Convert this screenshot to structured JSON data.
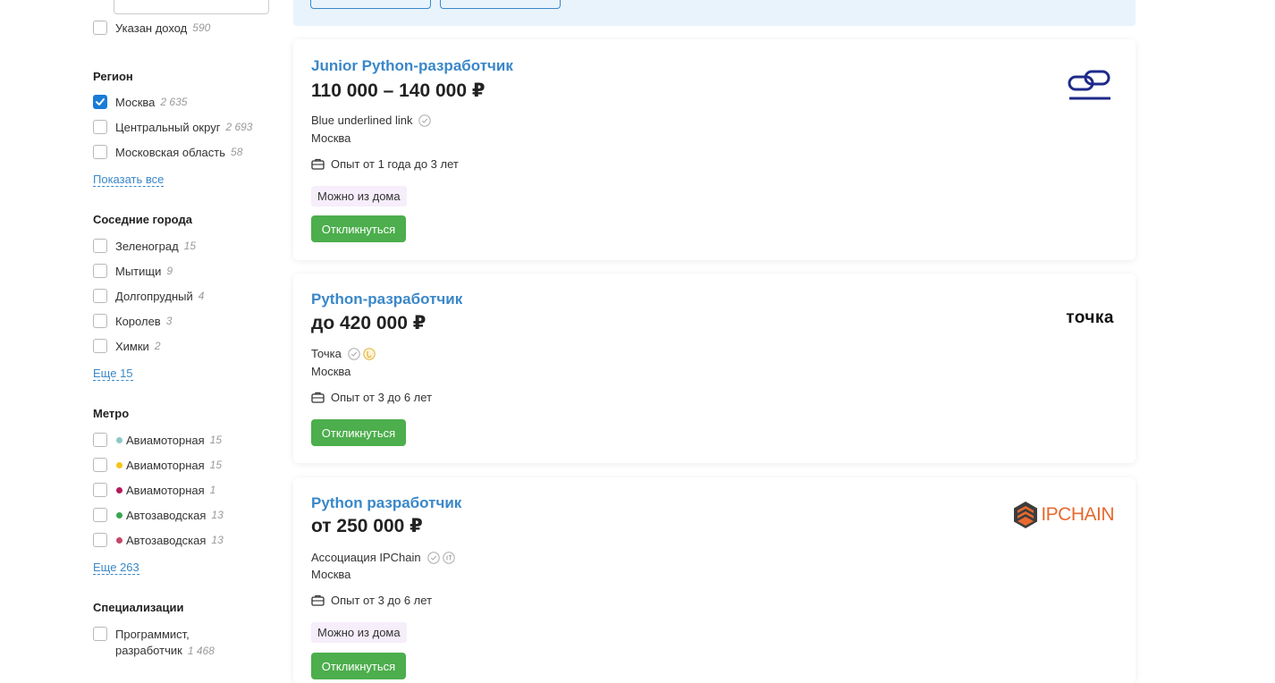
{
  "sidebar": {
    "income_filter": {
      "label": "Указан доход",
      "count": "590"
    },
    "region": {
      "title": "Регион",
      "items": [
        {
          "label": "Москва",
          "count": "2 635",
          "checked": true
        },
        {
          "label": "Центральный округ",
          "count": "2 693",
          "checked": false
        },
        {
          "label": "Московская область",
          "count": "58",
          "checked": false
        }
      ],
      "show_more": "Показать все"
    },
    "nearby_cities": {
      "title": "Соседние города",
      "items": [
        {
          "label": "Зеленоград",
          "count": "15"
        },
        {
          "label": "Мытищи",
          "count": "9"
        },
        {
          "label": "Долгопрудный",
          "count": "4"
        },
        {
          "label": "Королев",
          "count": "3"
        },
        {
          "label": "Химки",
          "count": "2"
        }
      ],
      "show_more": "Еще 15"
    },
    "metro": {
      "title": "Метро",
      "items": [
        {
          "label": "Авиамоторная",
          "count": "15",
          "color": "#8fc7c7"
        },
        {
          "label": "Авиамоторная",
          "count": "15",
          "color": "#f5c518"
        },
        {
          "label": "Авиамоторная",
          "count": "1",
          "color": "#b3195b"
        },
        {
          "label": "Автозаводская",
          "count": "13",
          "color": "#3aa551"
        },
        {
          "label": "Автозаводская",
          "count": "13",
          "color": "#c4476b"
        }
      ],
      "show_more": "Еще 263"
    },
    "specializations": {
      "title": "Специализации",
      "items": [
        {
          "label_line1": "Программист,",
          "label_line2": "разработчик",
          "count": "1 468"
        }
      ]
    }
  },
  "vacancies": [
    {
      "title": "Junior Python-разработчик",
      "salary": "110 000 – 140 000 ₽",
      "company": "Blue underlined link",
      "city": "Москва",
      "experience": "Опыт от 1 года до 3 лет",
      "tag": "Можно из дома",
      "apply": "Откликнуться"
    },
    {
      "title": "Python-разработчик",
      "salary": "до 420 000 ₽",
      "company": "Точка",
      "city": "Москва",
      "experience": "Опыт от 3 до 6 лет",
      "apply": "Откликнуться",
      "logo_text": "точка"
    },
    {
      "title": "Python разработчик",
      "salary": "от 250 000 ₽",
      "company": "Ассоциация IPChain",
      "city": "Москва",
      "experience": "Опыт от 3 до 6 лет",
      "tag": "Можно из дома",
      "apply": "Откликнуться",
      "logo_text": "IPCHAIN"
    }
  ],
  "colors": {
    "link": "#3a87c8",
    "apply": "#4cae4c",
    "checkbox_checked": "#1a7cd6",
    "banner": "#e8f3fc",
    "tag_bg": "#f6eefb",
    "ipchain_orange": "#e8692e"
  }
}
